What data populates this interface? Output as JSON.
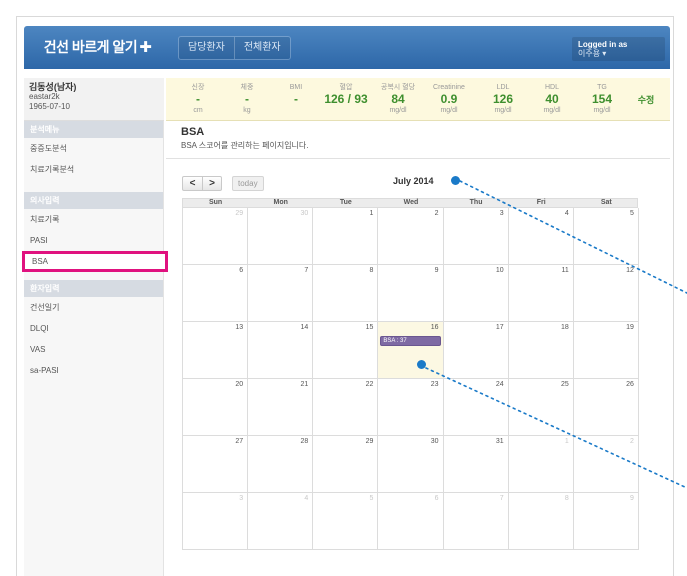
{
  "header": {
    "brand": "건선 바르게 알기",
    "brand_icon": "plus-icon",
    "tabs": [
      "담당환자",
      "전체환자"
    ],
    "login_label": "Logged in as",
    "user_name": "이주용 ▾"
  },
  "patient": {
    "name": "김동성(남자)",
    "id": "eastar2k",
    "birth": "1965-07-10"
  },
  "vitals": [
    {
      "label": "신장",
      "value": "-",
      "unit": "cm"
    },
    {
      "label": "체중",
      "value": "-",
      "unit": "kg"
    },
    {
      "label": "BMI",
      "value": "-",
      "unit": ""
    },
    {
      "label": "혈압",
      "value": "126 / 93",
      "unit": ""
    },
    {
      "label": "공복시 혈당",
      "value": "84",
      "unit": "mg/dl"
    },
    {
      "label": "Creatinine",
      "value": "0.9",
      "unit": "mg/dl"
    },
    {
      "label": "LDL",
      "value": "126",
      "unit": "mg/dl"
    },
    {
      "label": "HDL",
      "value": "40",
      "unit": "mg/dl"
    },
    {
      "label": "TG",
      "value": "154",
      "unit": "mg/dl"
    }
  ],
  "edit_label": "수정",
  "sidebar": {
    "sections": [
      {
        "title": "분석메뉴",
        "items": [
          "중증도분석",
          "치료기록분석"
        ]
      },
      {
        "title": "의사입력",
        "items": [
          "치료기록",
          "PASI",
          "BSA"
        ]
      },
      {
        "title": "환자입력",
        "items": [
          "건선일기",
          "DLQI",
          "VAS",
          "sa-PASI"
        ]
      }
    ],
    "active": "BSA"
  },
  "main": {
    "title": "BSA",
    "subtitle": "BSA 스코어를 관리하는 페이지입니다."
  },
  "calendar": {
    "prev": "<",
    "next": ">",
    "today_label": "today",
    "month_title": "July 2014",
    "weekdays": [
      "Sun",
      "Mon",
      "Tue",
      "Wed",
      "Thu",
      "Fri",
      "Sat"
    ],
    "weeks": [
      [
        {
          "n": "29",
          "o": true
        },
        {
          "n": "30",
          "o": true
        },
        {
          "n": "1"
        },
        {
          "n": "2"
        },
        {
          "n": "3"
        },
        {
          "n": "4"
        },
        {
          "n": "5"
        }
      ],
      [
        {
          "n": "6"
        },
        {
          "n": "7"
        },
        {
          "n": "8"
        },
        {
          "n": "9"
        },
        {
          "n": "10"
        },
        {
          "n": "11"
        },
        {
          "n": "12"
        }
      ],
      [
        {
          "n": "13"
        },
        {
          "n": "14"
        },
        {
          "n": "15"
        },
        {
          "n": "16",
          "today": true,
          "event": "BSA : 37"
        },
        {
          "n": "17"
        },
        {
          "n": "18"
        },
        {
          "n": "19"
        }
      ],
      [
        {
          "n": "20"
        },
        {
          "n": "21"
        },
        {
          "n": "22"
        },
        {
          "n": "23"
        },
        {
          "n": "24"
        },
        {
          "n": "25"
        },
        {
          "n": "26"
        }
      ],
      [
        {
          "n": "27"
        },
        {
          "n": "28"
        },
        {
          "n": "29"
        },
        {
          "n": "30"
        },
        {
          "n": "31"
        },
        {
          "n": "1",
          "o": true
        },
        {
          "n": "2",
          "o": true
        }
      ],
      [
        {
          "n": "3",
          "o": true
        },
        {
          "n": "4",
          "o": true
        },
        {
          "n": "5",
          "o": true
        },
        {
          "n": "6",
          "o": true
        },
        {
          "n": "7",
          "o": true
        },
        {
          "n": "8",
          "o": true
        },
        {
          "n": "9",
          "o": true
        }
      ]
    ]
  },
  "colors": {
    "header_blue": "#3a74b4",
    "highlight": "#e0127f",
    "value_green": "#3e8f2e",
    "event_purple": "#7e6aa3",
    "annotation_blue": "#1a7ac8"
  }
}
